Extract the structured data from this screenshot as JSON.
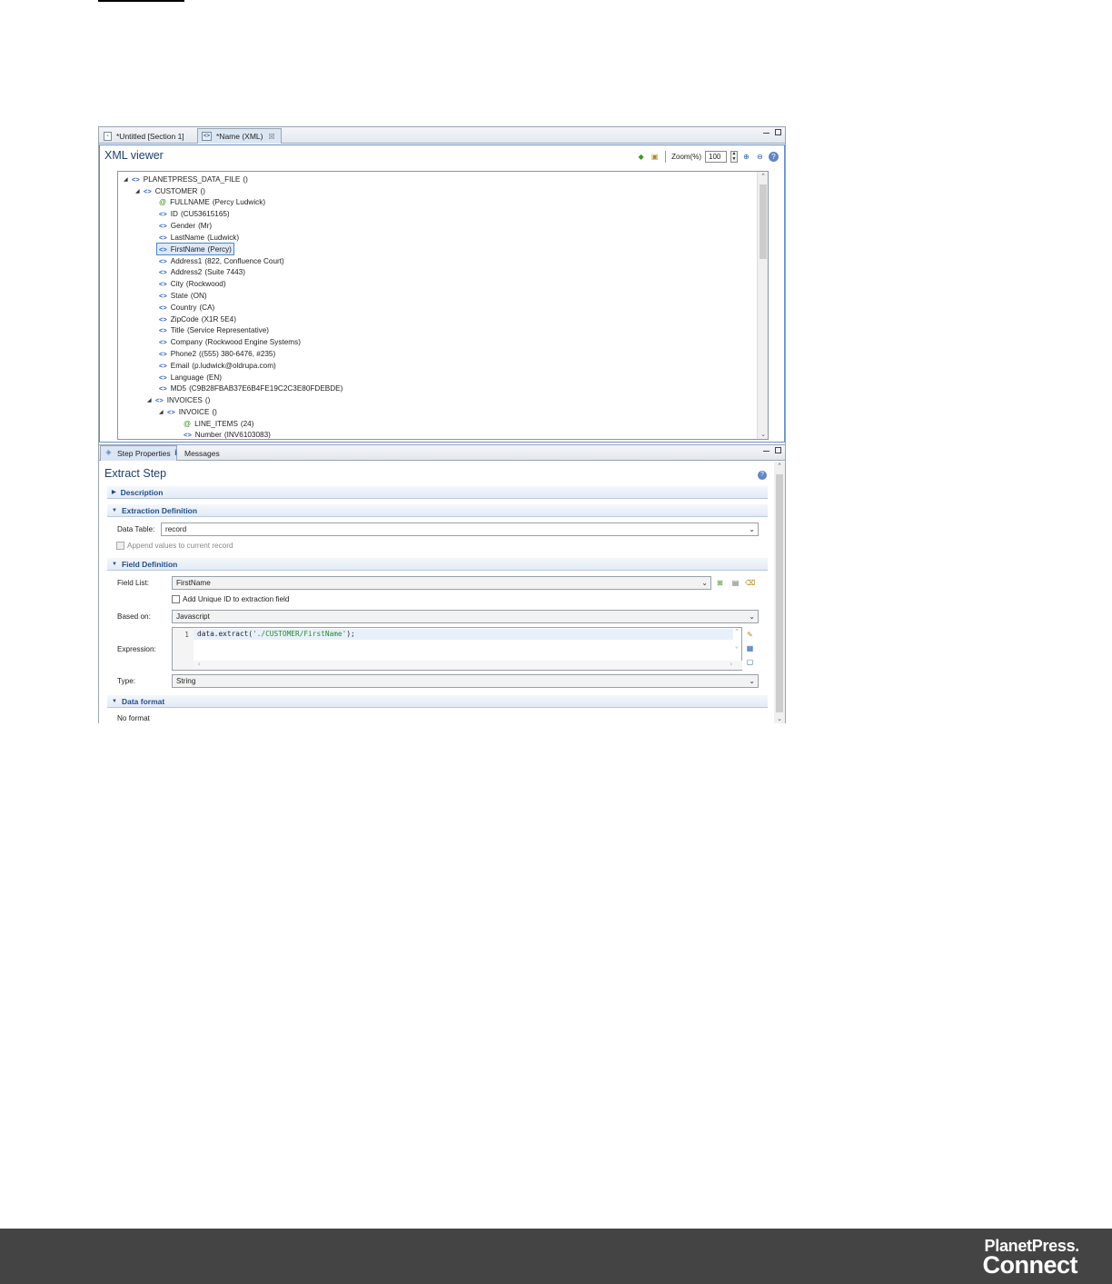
{
  "editor_tabs": [
    {
      "label": "*Untitled [Section 1]",
      "icon": "template-file-icon"
    },
    {
      "label": "*Name (XML)",
      "icon": "xml-file-icon",
      "close": "☒"
    }
  ],
  "xml_viewer": {
    "title": "XML viewer",
    "zoom_label": "Zoom(%)",
    "zoom_value": "100",
    "tree": [
      {
        "type": "element",
        "name": "PLANETPRESS_DATA_FILE",
        "value": "()",
        "expanded": true
      },
      {
        "type": "element",
        "name": "CUSTOMER",
        "value": "()",
        "expanded": true
      },
      {
        "type": "attribute",
        "name": "FULLNAME",
        "value": "(Percy Ludwick)"
      },
      {
        "type": "element",
        "name": "ID",
        "value": "(CU53615165)"
      },
      {
        "type": "element",
        "name": "Gender",
        "value": "(Mr)"
      },
      {
        "type": "element",
        "name": "LastName",
        "value": "(Ludwick)"
      },
      {
        "type": "element",
        "name": "FirstName",
        "value": "(Percy)",
        "selected": true
      },
      {
        "type": "element",
        "name": "Address1",
        "value": "(822, Confluence Court)"
      },
      {
        "type": "element",
        "name": "Address2",
        "value": "(Suite 7443)"
      },
      {
        "type": "element",
        "name": "City",
        "value": "(Rockwood)"
      },
      {
        "type": "element",
        "name": "State",
        "value": "(ON)"
      },
      {
        "type": "element",
        "name": "Country",
        "value": "(CA)"
      },
      {
        "type": "element",
        "name": "ZipCode",
        "value": "(X1R 5E4)"
      },
      {
        "type": "element",
        "name": "Title",
        "value": "(Service Representative)"
      },
      {
        "type": "element",
        "name": "Company",
        "value": "(Rockwood Engine Systems)"
      },
      {
        "type": "element",
        "name": "Phone2",
        "value": "((555) 380-6476, #235)"
      },
      {
        "type": "element",
        "name": "Email",
        "value": "(p.ludwick@oldrupa.com)"
      },
      {
        "type": "element",
        "name": "Language",
        "value": "(EN)"
      },
      {
        "type": "element",
        "name": "MD5",
        "value": "(C9B28FBAB37E6B4FE19C2C3E80FDEBDE)"
      },
      {
        "type": "element",
        "name": "INVOICES",
        "value": "()",
        "expanded": true
      },
      {
        "type": "element",
        "name": "INVOICE",
        "value": "()",
        "expanded": true
      },
      {
        "type": "attribute",
        "name": "LINE_ITEMS",
        "value": "(24)"
      },
      {
        "type": "element",
        "name": "Number",
        "value": "(INV6103083)"
      }
    ]
  },
  "bottom_tabs": [
    {
      "label": "Step Properties",
      "icon": "tag-icon"
    },
    {
      "label": "Messages",
      "icon": "info-icon",
      "glyph": "i"
    }
  ],
  "step": {
    "title": "Extract Step",
    "sections": {
      "description": "Description",
      "extraction_definition": "Extraction Definition",
      "field_definition": "Field Definition",
      "data_format": "Data format"
    },
    "data_table_label": "Data Table:",
    "data_table_value": "record",
    "append_label": "Append values to current record",
    "field_list_label": "Field List:",
    "field_list_value": "FirstName",
    "add_unique_id_label": "Add Unique ID to extraction field",
    "based_on_label": "Based on:",
    "based_on_value": "Javascript",
    "expression_label": "Expression:",
    "expression_line_number": "1",
    "expression_code_prefix": "data.extract(",
    "expression_code_string": "'./CUSTOMER/FirstName'",
    "expression_code_suffix": ");",
    "type_label": "Type:",
    "type_value": "String",
    "data_format_value": "No format"
  },
  "footer": {
    "logo_line1": "PlanetPress.",
    "logo_line2": "Connect",
    "background": "#444444"
  },
  "colors": {
    "panel_title": "#1f3f6e",
    "section_title": "#1f4e8c",
    "selection": "#dde9f8",
    "attribute_icon": "#3b8a1e",
    "element_icon": "#2a5db0"
  }
}
